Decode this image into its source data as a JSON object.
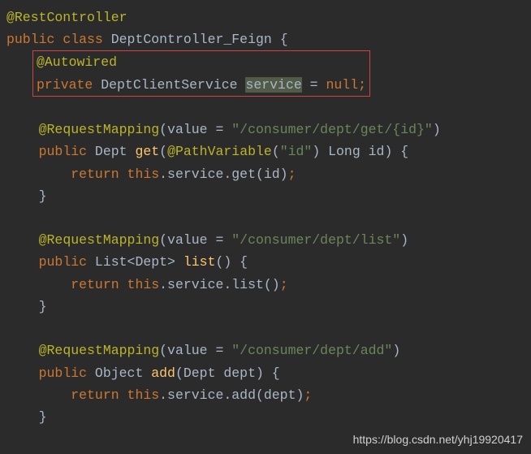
{
  "code": {
    "line1_anno": "@RestController",
    "line2_kw1": "public",
    "line2_kw2": "class",
    "line2_cls": "DeptController_Feign",
    "line2_brace": " {",
    "box_line1": "@Autowired",
    "box_line2_kw": "private",
    "box_line2_type": " DeptClientService ",
    "box_line2_sel": "service",
    "box_line2_eq": " = ",
    "box_line2_null": "null",
    "box_line2_semi": ";",
    "m1_anno": "@RequestMapping",
    "m1_paren1": "(value = ",
    "m1_str": "\"/consumer/dept/get/{id}\"",
    "m1_paren2": ")",
    "m1_sig_kw": "public",
    "m1_sig_type": " Dept ",
    "m1_sig_name": "get",
    "m1_sig_p1": "(",
    "m1_pv_anno": "@PathVariable",
    "m1_pv_p1": "(",
    "m1_pv_str": "\"id\"",
    "m1_pv_p2": ") Long id) {",
    "m1_body_kw": "return",
    "m1_body_this": " this",
    "m1_body_rest": ".service.get(id)",
    "m1_body_semi": ";",
    "m1_close": "}",
    "m2_anno": "@RequestMapping",
    "m2_paren1": "(value = ",
    "m2_str": "\"/consumer/dept/list\"",
    "m2_paren2": ")",
    "m2_sig_kw": "public",
    "m2_sig_type": " List<Dept> ",
    "m2_sig_name": "list",
    "m2_sig_rest": "() {",
    "m2_body_kw": "return",
    "m2_body_this": " this",
    "m2_body_rest": ".service.list()",
    "m2_body_semi": ";",
    "m2_close": "}",
    "m3_anno": "@RequestMapping",
    "m3_paren1": "(value = ",
    "m3_str": "\"/consumer/dept/add\"",
    "m3_paren2": ")",
    "m3_sig_kw": "public",
    "m3_sig_type": " Object ",
    "m3_sig_name": "add",
    "m3_sig_rest": "(Dept dept) {",
    "m3_body_kw": "return",
    "m3_body_this": " this",
    "m3_body_rest": ".service.add(dept)",
    "m3_body_semi": ";",
    "m3_close": "}"
  },
  "watermark": "https://blog.csdn.net/yhj19920417"
}
